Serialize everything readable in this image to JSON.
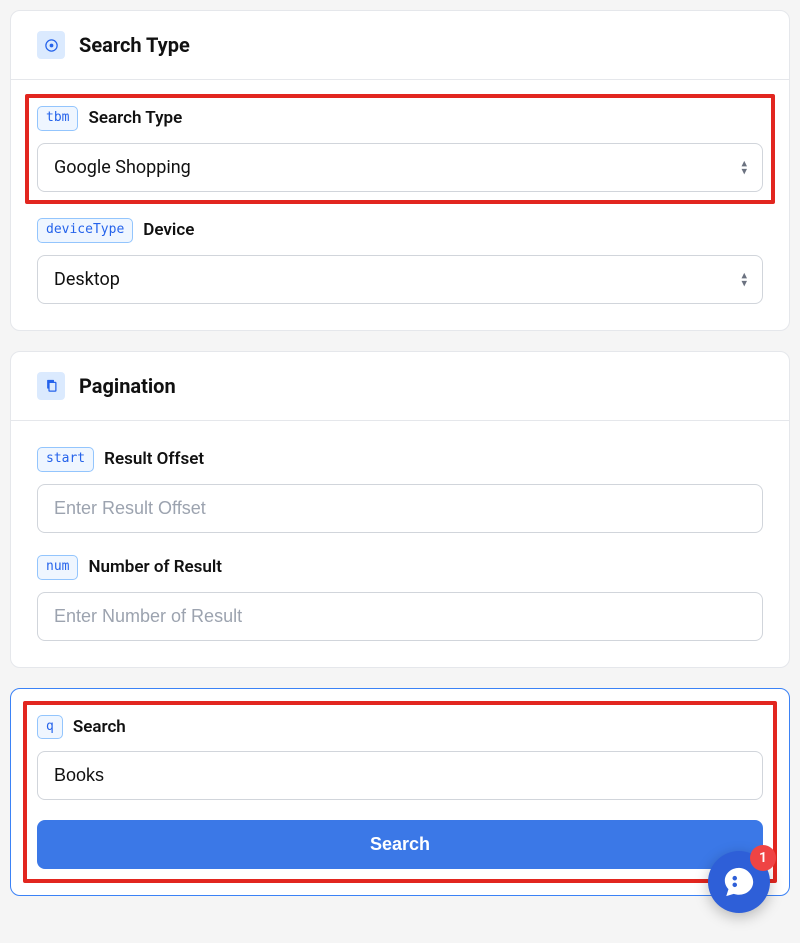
{
  "sections": {
    "searchType": {
      "title": "Search Type",
      "fields": {
        "tbm": {
          "badge": "tbm",
          "label": "Search Type",
          "value": "Google Shopping"
        },
        "deviceType": {
          "badge": "deviceType",
          "label": "Device",
          "value": "Desktop"
        }
      }
    },
    "pagination": {
      "title": "Pagination",
      "fields": {
        "start": {
          "badge": "start",
          "label": "Result Offset",
          "placeholder": "Enter Result Offset",
          "value": ""
        },
        "num": {
          "badge": "num",
          "label": "Number of Result",
          "placeholder": "Enter Number of Result",
          "value": ""
        }
      }
    },
    "search": {
      "badge": "q",
      "label": "Search",
      "value": "Books",
      "buttonLabel": "Search"
    }
  },
  "chat": {
    "badgeCount": "1"
  }
}
